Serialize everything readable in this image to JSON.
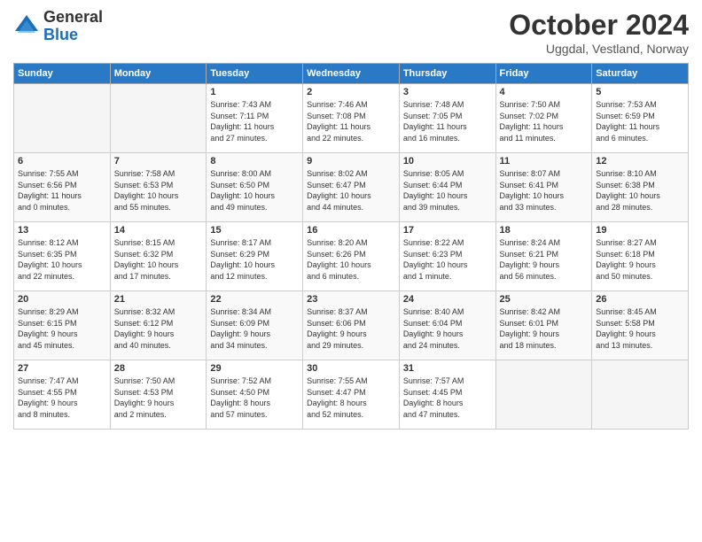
{
  "logo": {
    "general": "General",
    "blue": "Blue"
  },
  "header": {
    "title": "October 2024",
    "subtitle": "Uggdal, Vestland, Norway"
  },
  "weekdays": [
    "Sunday",
    "Monday",
    "Tuesday",
    "Wednesday",
    "Thursday",
    "Friday",
    "Saturday"
  ],
  "weeks": [
    [
      {
        "day": "",
        "content": ""
      },
      {
        "day": "",
        "content": ""
      },
      {
        "day": "1",
        "content": "Sunrise: 7:43 AM\nSunset: 7:11 PM\nDaylight: 11 hours\nand 27 minutes."
      },
      {
        "day": "2",
        "content": "Sunrise: 7:46 AM\nSunset: 7:08 PM\nDaylight: 11 hours\nand 22 minutes."
      },
      {
        "day": "3",
        "content": "Sunrise: 7:48 AM\nSunset: 7:05 PM\nDaylight: 11 hours\nand 16 minutes."
      },
      {
        "day": "4",
        "content": "Sunrise: 7:50 AM\nSunset: 7:02 PM\nDaylight: 11 hours\nand 11 minutes."
      },
      {
        "day": "5",
        "content": "Sunrise: 7:53 AM\nSunset: 6:59 PM\nDaylight: 11 hours\nand 6 minutes."
      }
    ],
    [
      {
        "day": "6",
        "content": "Sunrise: 7:55 AM\nSunset: 6:56 PM\nDaylight: 11 hours\nand 0 minutes."
      },
      {
        "day": "7",
        "content": "Sunrise: 7:58 AM\nSunset: 6:53 PM\nDaylight: 10 hours\nand 55 minutes."
      },
      {
        "day": "8",
        "content": "Sunrise: 8:00 AM\nSunset: 6:50 PM\nDaylight: 10 hours\nand 49 minutes."
      },
      {
        "day": "9",
        "content": "Sunrise: 8:02 AM\nSunset: 6:47 PM\nDaylight: 10 hours\nand 44 minutes."
      },
      {
        "day": "10",
        "content": "Sunrise: 8:05 AM\nSunset: 6:44 PM\nDaylight: 10 hours\nand 39 minutes."
      },
      {
        "day": "11",
        "content": "Sunrise: 8:07 AM\nSunset: 6:41 PM\nDaylight: 10 hours\nand 33 minutes."
      },
      {
        "day": "12",
        "content": "Sunrise: 8:10 AM\nSunset: 6:38 PM\nDaylight: 10 hours\nand 28 minutes."
      }
    ],
    [
      {
        "day": "13",
        "content": "Sunrise: 8:12 AM\nSunset: 6:35 PM\nDaylight: 10 hours\nand 22 minutes."
      },
      {
        "day": "14",
        "content": "Sunrise: 8:15 AM\nSunset: 6:32 PM\nDaylight: 10 hours\nand 17 minutes."
      },
      {
        "day": "15",
        "content": "Sunrise: 8:17 AM\nSunset: 6:29 PM\nDaylight: 10 hours\nand 12 minutes."
      },
      {
        "day": "16",
        "content": "Sunrise: 8:20 AM\nSunset: 6:26 PM\nDaylight: 10 hours\nand 6 minutes."
      },
      {
        "day": "17",
        "content": "Sunrise: 8:22 AM\nSunset: 6:23 PM\nDaylight: 10 hours\nand 1 minute."
      },
      {
        "day": "18",
        "content": "Sunrise: 8:24 AM\nSunset: 6:21 PM\nDaylight: 9 hours\nand 56 minutes."
      },
      {
        "day": "19",
        "content": "Sunrise: 8:27 AM\nSunset: 6:18 PM\nDaylight: 9 hours\nand 50 minutes."
      }
    ],
    [
      {
        "day": "20",
        "content": "Sunrise: 8:29 AM\nSunset: 6:15 PM\nDaylight: 9 hours\nand 45 minutes."
      },
      {
        "day": "21",
        "content": "Sunrise: 8:32 AM\nSunset: 6:12 PM\nDaylight: 9 hours\nand 40 minutes."
      },
      {
        "day": "22",
        "content": "Sunrise: 8:34 AM\nSunset: 6:09 PM\nDaylight: 9 hours\nand 34 minutes."
      },
      {
        "day": "23",
        "content": "Sunrise: 8:37 AM\nSunset: 6:06 PM\nDaylight: 9 hours\nand 29 minutes."
      },
      {
        "day": "24",
        "content": "Sunrise: 8:40 AM\nSunset: 6:04 PM\nDaylight: 9 hours\nand 24 minutes."
      },
      {
        "day": "25",
        "content": "Sunrise: 8:42 AM\nSunset: 6:01 PM\nDaylight: 9 hours\nand 18 minutes."
      },
      {
        "day": "26",
        "content": "Sunrise: 8:45 AM\nSunset: 5:58 PM\nDaylight: 9 hours\nand 13 minutes."
      }
    ],
    [
      {
        "day": "27",
        "content": "Sunrise: 7:47 AM\nSunset: 4:55 PM\nDaylight: 9 hours\nand 8 minutes."
      },
      {
        "day": "28",
        "content": "Sunrise: 7:50 AM\nSunset: 4:53 PM\nDaylight: 9 hours\nand 2 minutes."
      },
      {
        "day": "29",
        "content": "Sunrise: 7:52 AM\nSunset: 4:50 PM\nDaylight: 8 hours\nand 57 minutes."
      },
      {
        "day": "30",
        "content": "Sunrise: 7:55 AM\nSunset: 4:47 PM\nDaylight: 8 hours\nand 52 minutes."
      },
      {
        "day": "31",
        "content": "Sunrise: 7:57 AM\nSunset: 4:45 PM\nDaylight: 8 hours\nand 47 minutes."
      },
      {
        "day": "",
        "content": ""
      },
      {
        "day": "",
        "content": ""
      }
    ]
  ]
}
